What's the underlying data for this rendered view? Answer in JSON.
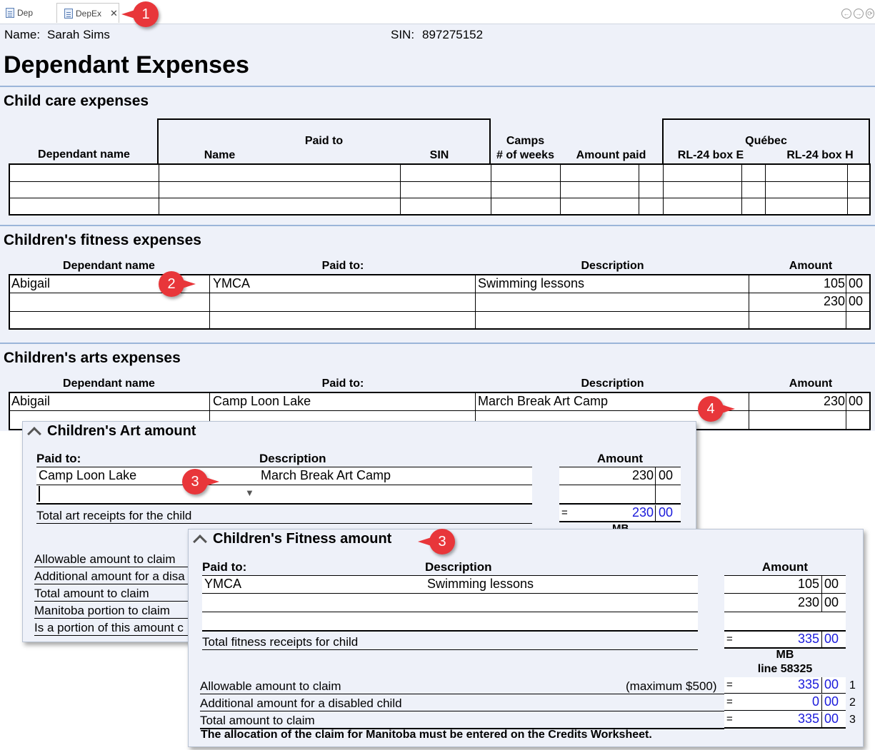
{
  "tabs": [
    {
      "label": "Dep"
    },
    {
      "label": "DepEx"
    }
  ],
  "header": {
    "name_label": "Name:",
    "name_value": "Sarah Sims",
    "sin_label": "SIN:",
    "sin_value": "897275152",
    "title": "Dependant Expenses"
  },
  "child_care": {
    "section_title": "Child care expenses",
    "h_dependant": "Dependant name",
    "h_paid_to": "Paid to",
    "h_name": "Name",
    "h_sin": "SIN",
    "h_camps": "Camps",
    "h_weeks": "# of weeks",
    "h_amount_paid": "Amount paid",
    "h_quebec": "Québec",
    "h_rl24e": "RL-24 box E",
    "h_rl24h": "RL-24 box H"
  },
  "fitness": {
    "section_title": "Children's fitness expenses",
    "h_dependant": "Dependant name",
    "h_paid_to": "Paid to:",
    "h_description": "Description",
    "h_amount": "Amount",
    "rows": [
      {
        "dependant": "Abigail",
        "paid_to": "YMCA",
        "description": "Swimming lessons",
        "dollars": "105",
        "cents": "00"
      },
      {
        "dependant": "",
        "paid_to": "",
        "description": "",
        "dollars": "230",
        "cents": "00"
      },
      {
        "dependant": "",
        "paid_to": "",
        "description": "",
        "dollars": "",
        "cents": ""
      }
    ]
  },
  "arts": {
    "section_title": "Children's arts expenses",
    "h_dependant": "Dependant name",
    "h_paid_to": "Paid to:",
    "h_description": "Description",
    "h_amount": "Amount",
    "rows": [
      {
        "dependant": "Abigail",
        "paid_to": "Camp Loon Lake",
        "description": "March Break Art Camp",
        "dollars": "230",
        "cents": "00"
      }
    ]
  },
  "art_panel": {
    "title": "Children's Art amount",
    "h_paid_to": "Paid to:",
    "h_description": "Description",
    "h_amount": "Amount",
    "row1": {
      "paid_to": "Camp Loon Lake",
      "description": "March Break Art Camp",
      "dollars": "230",
      "cents": "00"
    },
    "dropdown_arrow": "▼",
    "total_label": "Total art receipts for the child",
    "total_eq": "=",
    "total_dollars": "230",
    "total_cents": "00",
    "mb_partial": "MB",
    "lines": [
      "Allowable amount to claim",
      "Additional amount for a disa",
      "Total amount to claim",
      "Manitoba portion to claim",
      "Is a portion of this amount c"
    ]
  },
  "fitness_panel": {
    "title": "Children's Fitness amount",
    "h_paid_to": "Paid to:",
    "h_description": "Description",
    "h_amount": "Amount",
    "row1": {
      "paid_to": "YMCA",
      "description": "Swimming lessons",
      "dollars": "105",
      "cents": "00"
    },
    "row2": {
      "dollars": "230",
      "cents": "00"
    },
    "total_label": "Total fitness receipts for child",
    "total_eq": "=",
    "total_dollars": "335",
    "total_cents": "00",
    "mb": "MB",
    "mb_line": "line 58325",
    "allow_label": "Allowable amount to claim",
    "allow_max": "(maximum $500)",
    "allow_eq": "=",
    "allow_dollars": "335",
    "allow_cents": "00",
    "allow_num": "1",
    "add_label": "Additional amount for a disabled child",
    "add_eq": "=",
    "add_dollars": "0",
    "add_cents": "00",
    "add_num": "2",
    "total_claim_label": "Total amount to claim",
    "tc_eq": "=",
    "tc_dollars": "335",
    "tc_cents": "00",
    "tc_num": "3",
    "note": "The allocation of the claim for Manitoba must be entered on the Credits Worksheet."
  },
  "callouts": [
    "1",
    "2",
    "3",
    "3",
    "4"
  ],
  "colors": {
    "form_bg": "#eef1f9",
    "separator": "#9bb5d9",
    "callout": "#e8363a",
    "link_blue": "#1a1adb"
  }
}
